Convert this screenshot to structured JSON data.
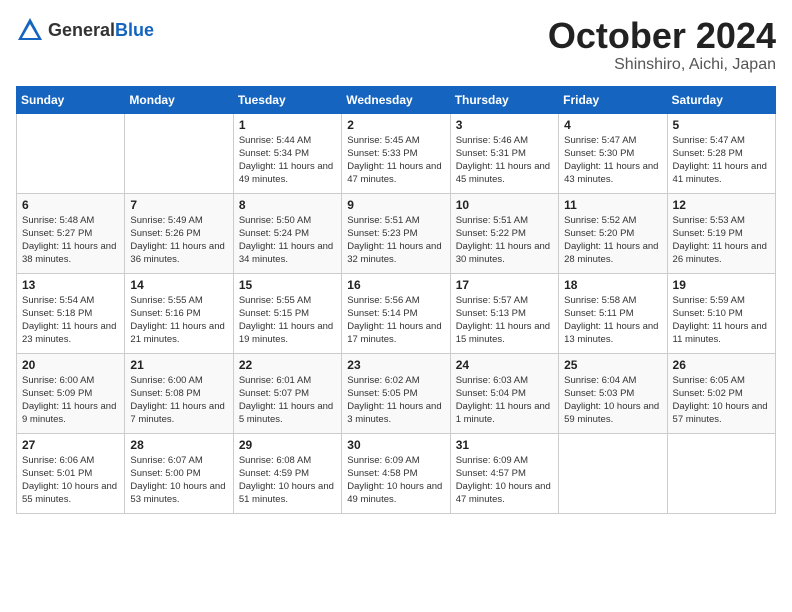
{
  "header": {
    "logo_general": "General",
    "logo_blue": "Blue",
    "month_title": "October 2024",
    "subtitle": "Shinshiro, Aichi, Japan"
  },
  "weekdays": [
    "Sunday",
    "Monday",
    "Tuesday",
    "Wednesday",
    "Thursday",
    "Friday",
    "Saturday"
  ],
  "weeks": [
    [
      {
        "day": "",
        "info": ""
      },
      {
        "day": "",
        "info": ""
      },
      {
        "day": "1",
        "info": "Sunrise: 5:44 AM\nSunset: 5:34 PM\nDaylight: 11 hours and 49 minutes."
      },
      {
        "day": "2",
        "info": "Sunrise: 5:45 AM\nSunset: 5:33 PM\nDaylight: 11 hours and 47 minutes."
      },
      {
        "day": "3",
        "info": "Sunrise: 5:46 AM\nSunset: 5:31 PM\nDaylight: 11 hours and 45 minutes."
      },
      {
        "day": "4",
        "info": "Sunrise: 5:47 AM\nSunset: 5:30 PM\nDaylight: 11 hours and 43 minutes."
      },
      {
        "day": "5",
        "info": "Sunrise: 5:47 AM\nSunset: 5:28 PM\nDaylight: 11 hours and 41 minutes."
      }
    ],
    [
      {
        "day": "6",
        "info": "Sunrise: 5:48 AM\nSunset: 5:27 PM\nDaylight: 11 hours and 38 minutes."
      },
      {
        "day": "7",
        "info": "Sunrise: 5:49 AM\nSunset: 5:26 PM\nDaylight: 11 hours and 36 minutes."
      },
      {
        "day": "8",
        "info": "Sunrise: 5:50 AM\nSunset: 5:24 PM\nDaylight: 11 hours and 34 minutes."
      },
      {
        "day": "9",
        "info": "Sunrise: 5:51 AM\nSunset: 5:23 PM\nDaylight: 11 hours and 32 minutes."
      },
      {
        "day": "10",
        "info": "Sunrise: 5:51 AM\nSunset: 5:22 PM\nDaylight: 11 hours and 30 minutes."
      },
      {
        "day": "11",
        "info": "Sunrise: 5:52 AM\nSunset: 5:20 PM\nDaylight: 11 hours and 28 minutes."
      },
      {
        "day": "12",
        "info": "Sunrise: 5:53 AM\nSunset: 5:19 PM\nDaylight: 11 hours and 26 minutes."
      }
    ],
    [
      {
        "day": "13",
        "info": "Sunrise: 5:54 AM\nSunset: 5:18 PM\nDaylight: 11 hours and 23 minutes."
      },
      {
        "day": "14",
        "info": "Sunrise: 5:55 AM\nSunset: 5:16 PM\nDaylight: 11 hours and 21 minutes."
      },
      {
        "day": "15",
        "info": "Sunrise: 5:55 AM\nSunset: 5:15 PM\nDaylight: 11 hours and 19 minutes."
      },
      {
        "day": "16",
        "info": "Sunrise: 5:56 AM\nSunset: 5:14 PM\nDaylight: 11 hours and 17 minutes."
      },
      {
        "day": "17",
        "info": "Sunrise: 5:57 AM\nSunset: 5:13 PM\nDaylight: 11 hours and 15 minutes."
      },
      {
        "day": "18",
        "info": "Sunrise: 5:58 AM\nSunset: 5:11 PM\nDaylight: 11 hours and 13 minutes."
      },
      {
        "day": "19",
        "info": "Sunrise: 5:59 AM\nSunset: 5:10 PM\nDaylight: 11 hours and 11 minutes."
      }
    ],
    [
      {
        "day": "20",
        "info": "Sunrise: 6:00 AM\nSunset: 5:09 PM\nDaylight: 11 hours and 9 minutes."
      },
      {
        "day": "21",
        "info": "Sunrise: 6:00 AM\nSunset: 5:08 PM\nDaylight: 11 hours and 7 minutes."
      },
      {
        "day": "22",
        "info": "Sunrise: 6:01 AM\nSunset: 5:07 PM\nDaylight: 11 hours and 5 minutes."
      },
      {
        "day": "23",
        "info": "Sunrise: 6:02 AM\nSunset: 5:05 PM\nDaylight: 11 hours and 3 minutes."
      },
      {
        "day": "24",
        "info": "Sunrise: 6:03 AM\nSunset: 5:04 PM\nDaylight: 11 hours and 1 minute."
      },
      {
        "day": "25",
        "info": "Sunrise: 6:04 AM\nSunset: 5:03 PM\nDaylight: 10 hours and 59 minutes."
      },
      {
        "day": "26",
        "info": "Sunrise: 6:05 AM\nSunset: 5:02 PM\nDaylight: 10 hours and 57 minutes."
      }
    ],
    [
      {
        "day": "27",
        "info": "Sunrise: 6:06 AM\nSunset: 5:01 PM\nDaylight: 10 hours and 55 minutes."
      },
      {
        "day": "28",
        "info": "Sunrise: 6:07 AM\nSunset: 5:00 PM\nDaylight: 10 hours and 53 minutes."
      },
      {
        "day": "29",
        "info": "Sunrise: 6:08 AM\nSunset: 4:59 PM\nDaylight: 10 hours and 51 minutes."
      },
      {
        "day": "30",
        "info": "Sunrise: 6:09 AM\nSunset: 4:58 PM\nDaylight: 10 hours and 49 minutes."
      },
      {
        "day": "31",
        "info": "Sunrise: 6:09 AM\nSunset: 4:57 PM\nDaylight: 10 hours and 47 minutes."
      },
      {
        "day": "",
        "info": ""
      },
      {
        "day": "",
        "info": ""
      }
    ]
  ]
}
